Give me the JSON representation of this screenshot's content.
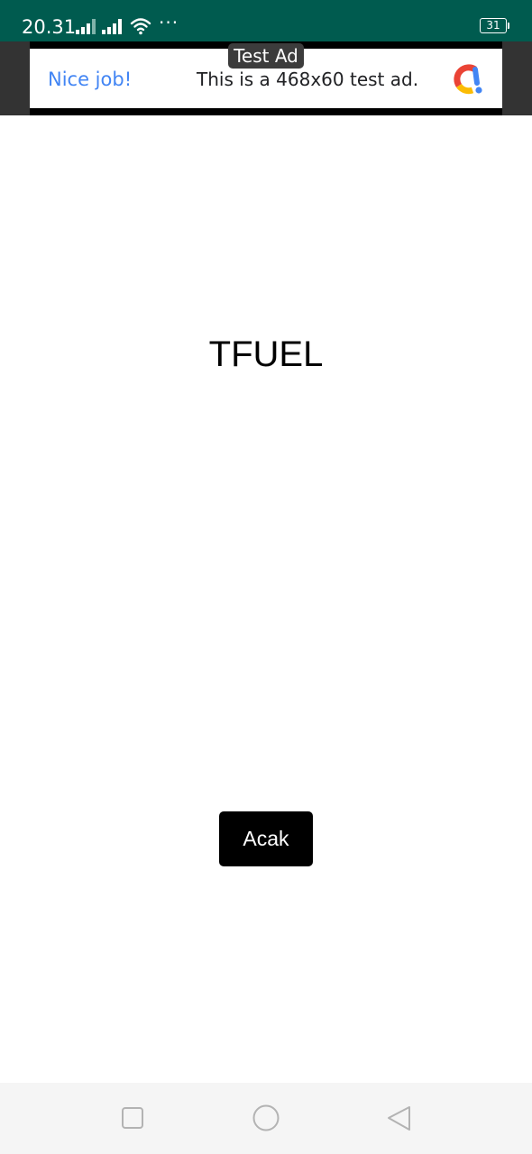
{
  "status_bar": {
    "time": "20.31",
    "dots": "···",
    "battery": "31",
    "color": "#005b4f"
  },
  "ad": {
    "badge": "Test Ad",
    "headline": "Nice job!",
    "body": "This is a 468x60 test ad.",
    "headline_color": "#4285f4"
  },
  "main": {
    "word": "TFUEL",
    "button_label": "Acak"
  },
  "nav": {
    "recent_icon": "square-icon",
    "home_icon": "circle-icon",
    "back_icon": "triangle-back-icon"
  }
}
